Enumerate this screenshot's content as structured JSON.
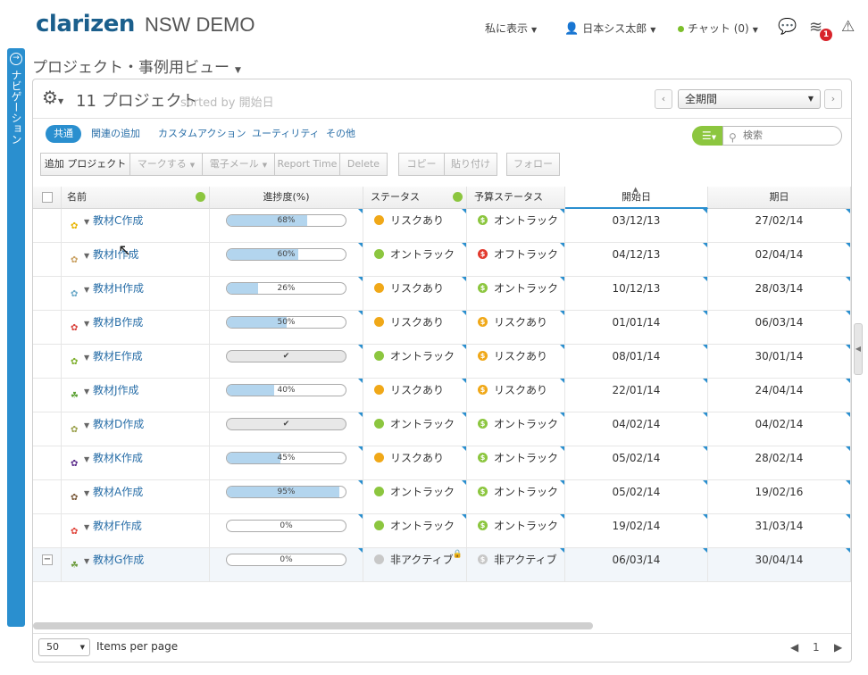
{
  "app": {
    "logo": "clarizen",
    "workspace": "NSW DEMO",
    "menu_display": "私に表示",
    "user_name": "日本シス太郎",
    "chat_label": "チャット (0)",
    "notification_count": "1"
  },
  "nav": {
    "label": "ナビゲーション"
  },
  "view": {
    "title": "プロジェクト・事例用ビュー"
  },
  "panel": {
    "count_title": "11 プロジェクト",
    "sorted_by": "sorted by 開始日",
    "period": "全期間"
  },
  "tabs": [
    "共通",
    "関連の追加",
    "カスタムアクション",
    "ユーティリティ",
    "その他"
  ],
  "search": {
    "placeholder": "検索"
  },
  "toolbar": {
    "add_project": "追加 プロジェクト",
    "mark": "マークする",
    "email": "電子メール",
    "report_time": "Report Time",
    "delete": "Delete",
    "copy": "コピー",
    "paste": "貼り付け",
    "follow": "フォロー"
  },
  "columns": {
    "name": "名前",
    "progress": "進捗度(%)",
    "status": "ステータス",
    "budget_status": "予算ステータス",
    "start_date": "開始日",
    "due_date": "期日"
  },
  "colors": {
    "ontrack": "#8cc63f",
    "risk": "#f0a818",
    "offtrack": "#e23a2e",
    "inactive": "#c8c8c8",
    "accent": "#2a8fcf"
  },
  "rows": [
    {
      "name": "教材C作成",
      "icon": "flower-icon",
      "icon_color": "#e8b400",
      "progress": "68%",
      "progress_value": 0.68,
      "done": false,
      "status": "リスクあり",
      "status_key": "risk",
      "budget": "オントラック",
      "budget_key": "ontrack",
      "start": "03/12/13",
      "due": "27/02/14"
    },
    {
      "name": "教材I作成",
      "icon": "flower-icon",
      "icon_color": "#c9a060",
      "progress": "60%",
      "progress_value": 0.6,
      "done": false,
      "status": "オントラック",
      "status_key": "ontrack",
      "budget": "オフトラック",
      "budget_key": "offtrack",
      "start": "04/12/13",
      "due": "02/04/14"
    },
    {
      "name": "教材H作成",
      "icon": "flower-icon",
      "icon_color": "#6aa8c8",
      "progress": "26%",
      "progress_value": 0.26,
      "done": false,
      "status": "リスクあり",
      "status_key": "risk",
      "budget": "オントラック",
      "budget_key": "ontrack",
      "start": "10/12/13",
      "due": "28/03/14"
    },
    {
      "name": "教材B作成",
      "icon": "flower-icon",
      "icon_color": "#d8403a",
      "progress": "50%",
      "progress_value": 0.5,
      "done": false,
      "status": "リスクあり",
      "status_key": "risk",
      "budget": "リスクあり",
      "budget_key": "risk",
      "start": "01/01/14",
      "due": "06/03/14"
    },
    {
      "name": "教材E作成",
      "icon": "flower-icon",
      "icon_color": "#7cae2a",
      "progress": "",
      "progress_value": 1.0,
      "done": true,
      "status": "オントラック",
      "status_key": "ontrack",
      "budget": "リスクあり",
      "budget_key": "risk",
      "start": "08/01/14",
      "due": "30/01/14"
    },
    {
      "name": "教材J作成",
      "icon": "leaf-icon",
      "icon_color": "#5aa032",
      "progress": "40%",
      "progress_value": 0.4,
      "done": false,
      "status": "リスクあり",
      "status_key": "risk",
      "budget": "リスクあり",
      "budget_key": "risk",
      "start": "22/01/14",
      "due": "24/04/14"
    },
    {
      "name": "教材D作成",
      "icon": "flower-icon",
      "icon_color": "#9aa04a",
      "progress": "",
      "progress_value": 1.0,
      "done": true,
      "status": "オントラック",
      "status_key": "ontrack",
      "budget": "オントラック",
      "budget_key": "ontrack",
      "start": "04/02/14",
      "due": "04/02/14"
    },
    {
      "name": "教材K作成",
      "icon": "flower-icon",
      "icon_color": "#5a2a8a",
      "progress": "45%",
      "progress_value": 0.45,
      "done": false,
      "status": "リスクあり",
      "status_key": "risk",
      "budget": "オントラック",
      "budget_key": "ontrack",
      "start": "05/02/14",
      "due": "28/02/14"
    },
    {
      "name": "教材A作成",
      "icon": "flower-icon",
      "icon_color": "#7a5a3a",
      "progress": "95%",
      "progress_value": 0.95,
      "done": false,
      "status": "オントラック",
      "status_key": "ontrack",
      "budget": "オントラック",
      "budget_key": "ontrack",
      "start": "05/02/14",
      "due": "19/02/16"
    },
    {
      "name": "教材F作成",
      "icon": "flower-icon",
      "icon_color": "#e0443a",
      "progress": "0%",
      "progress_value": 0.0,
      "done": false,
      "status": "オントラック",
      "status_key": "ontrack",
      "budget": "オントラック",
      "budget_key": "ontrack",
      "start": "19/02/14",
      "due": "31/03/14"
    },
    {
      "name": "教材G作成",
      "icon": "leaf-icon",
      "icon_color": "#6a9a3a",
      "progress": "0%",
      "progress_value": 0.0,
      "done": false,
      "status": "非アクティブ",
      "status_key": "inactive",
      "budget": "非アクティブ",
      "budget_key": "inactive",
      "start": "06/03/14",
      "due": "30/04/14",
      "selected": true
    }
  ],
  "footer": {
    "per_page": "50",
    "per_page_label": "Items per page",
    "page": "1"
  }
}
